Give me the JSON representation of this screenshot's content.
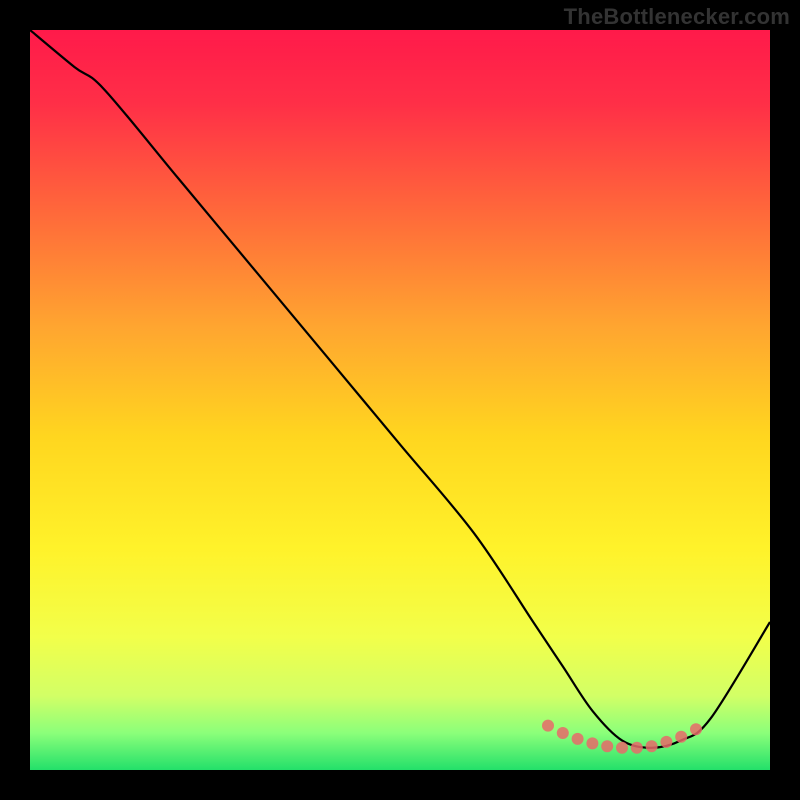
{
  "watermark": "TheBottlenecker.com",
  "chart_data": {
    "type": "line",
    "title": "",
    "xlabel": "",
    "ylabel": "",
    "xlim": [
      0,
      100
    ],
    "ylim": [
      0,
      100
    ],
    "grid": false,
    "legend": false,
    "curve": {
      "name": "bottleneck-curve",
      "x": [
        0,
        6,
        10,
        20,
        30,
        40,
        50,
        60,
        68,
        72,
        76,
        80,
        84,
        88,
        92,
        100
      ],
      "y": [
        100,
        95,
        92,
        80,
        68,
        56,
        44,
        32,
        20,
        14,
        8,
        4,
        3,
        4,
        7,
        20
      ]
    },
    "markers": {
      "name": "optimal-range",
      "x": [
        70,
        72,
        74,
        76,
        78,
        80,
        82,
        84,
        86,
        88,
        90
      ],
      "y": [
        6,
        5,
        4.2,
        3.6,
        3.2,
        3,
        3,
        3.2,
        3.8,
        4.5,
        5.5
      ]
    },
    "gradient_stops": [
      {
        "offset": 0.0,
        "color": "#ff1a4a"
      },
      {
        "offset": 0.1,
        "color": "#ff2f47"
      },
      {
        "offset": 0.25,
        "color": "#ff6a3a"
      },
      {
        "offset": 0.4,
        "color": "#ffa530"
      },
      {
        "offset": 0.55,
        "color": "#ffd61f"
      },
      {
        "offset": 0.7,
        "color": "#fff22a"
      },
      {
        "offset": 0.82,
        "color": "#f2ff4a"
      },
      {
        "offset": 0.9,
        "color": "#d2ff66"
      },
      {
        "offset": 0.95,
        "color": "#8bff7a"
      },
      {
        "offset": 1.0,
        "color": "#23e06a"
      }
    ]
  }
}
